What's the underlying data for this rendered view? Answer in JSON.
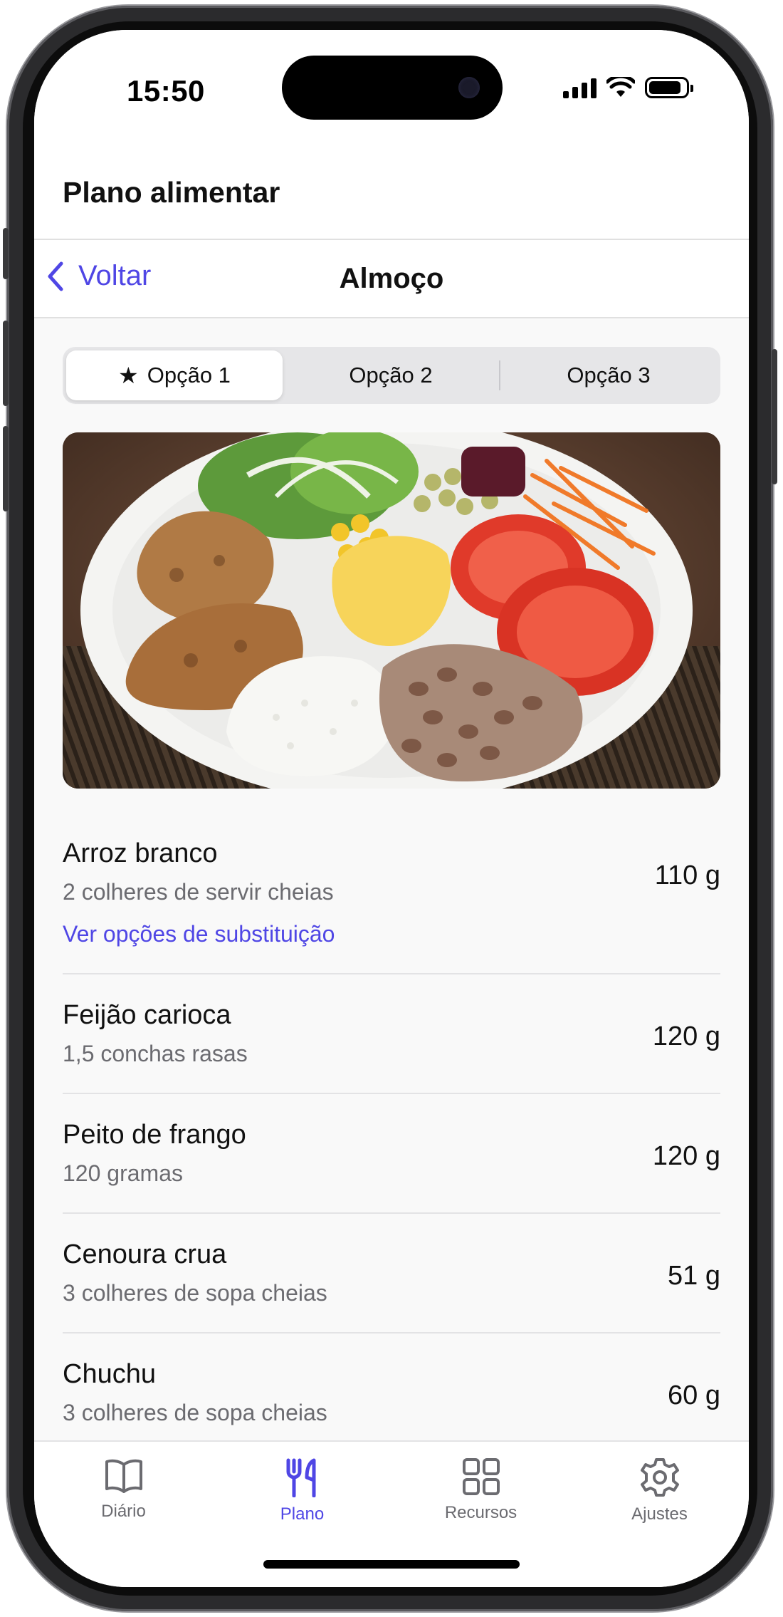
{
  "status_bar": {
    "time": "15:50"
  },
  "app": {
    "title": "Plano alimentar"
  },
  "nav": {
    "back_label": "Voltar",
    "title": "Almoço"
  },
  "segments": [
    {
      "label": "Opção 1",
      "selected": true,
      "icon": "star-icon"
    },
    {
      "label": "Opção 2",
      "selected": false
    },
    {
      "label": "Opção 3",
      "selected": false
    }
  ],
  "meal_photo": {
    "subject": "plate-of-rice-beans-chicken-salad"
  },
  "foods": [
    {
      "name": "Arroz branco",
      "portion": "2 colheres de servir cheias",
      "quantity": "110 g",
      "link": "Ver opções de substituição"
    },
    {
      "name": "Feijão carioca",
      "portion": "1,5 conchas rasas",
      "quantity": "120 g"
    },
    {
      "name": "Peito de frango",
      "portion": "120 gramas",
      "quantity": "120 g"
    },
    {
      "name": "Cenoura crua",
      "portion": "3 colheres de sopa cheias",
      "quantity": "51 g"
    },
    {
      "name": "Chuchu",
      "portion": "3 colheres de sopa cheias",
      "quantity": "60 g"
    }
  ],
  "tabs": [
    {
      "label": "Diário",
      "icon": "book-icon",
      "active": false
    },
    {
      "label": "Plano",
      "icon": "fork-knife-icon",
      "active": true
    },
    {
      "label": "Recursos",
      "icon": "grid-icon",
      "active": false
    },
    {
      "label": "Ajustes",
      "icon": "gear-icon",
      "active": false
    }
  ],
  "colors": {
    "accent": "#4f46e5",
    "secondary_text": "#6b6b70",
    "background": "#f9f9f9"
  }
}
